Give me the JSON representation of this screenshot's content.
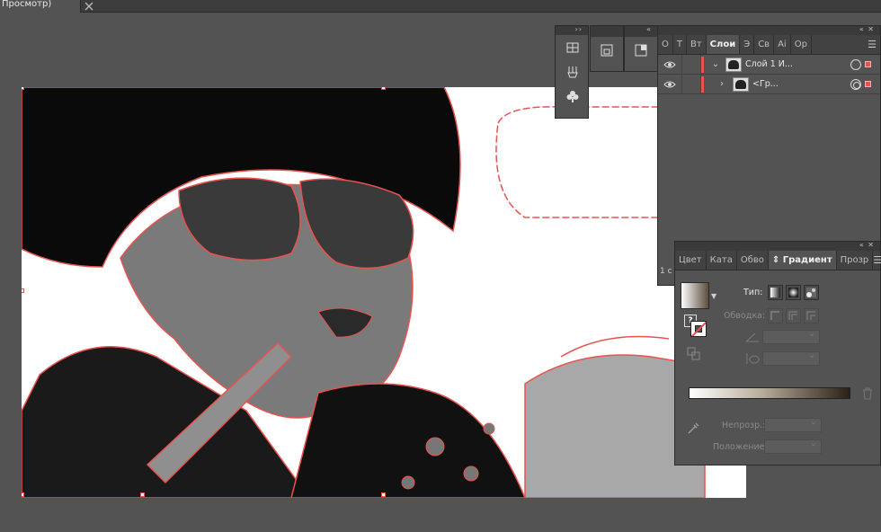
{
  "document": {
    "tab_title": "Просмотр)"
  },
  "layers_panel": {
    "tabs": [
      {
        "label": "О"
      },
      {
        "label": "Т"
      },
      {
        "label": "Вт"
      },
      {
        "label": "Слои"
      },
      {
        "label": "Э"
      },
      {
        "label": "Св"
      },
      {
        "label": "Аі"
      },
      {
        "label": "Ор"
      }
    ],
    "active_tab": "Слои",
    "rows": [
      {
        "name": "Слой 1 И..."
      },
      {
        "name": "<Гр..."
      }
    ],
    "footer": "1 с"
  },
  "gradient_panel": {
    "tabs": [
      {
        "label": "Цвет"
      },
      {
        "label": "Ката"
      },
      {
        "label": "Обво"
      },
      {
        "label": "Градиент"
      },
      {
        "label": "Прозр"
      }
    ],
    "active_tab": "Градиент",
    "type_label": "Тип:",
    "stroke_label": "Обводка:",
    "opacity_label": "Непрозр.:",
    "position_label": "Положение:",
    "swatch_indicator": "?",
    "gradient_colors": [
      "#ffffff",
      "#b8ad9b",
      "#2a2016"
    ]
  },
  "colors": {
    "selection": "#e8534f",
    "panel_bg": "#535353",
    "workspace_bg": "#535353"
  }
}
